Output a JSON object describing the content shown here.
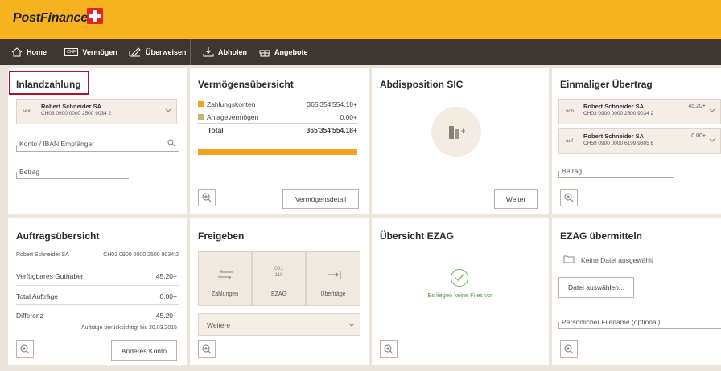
{
  "brand": {
    "name": "PostFinance",
    "accent": "#f5b41f",
    "nav_bg": "#3e3731",
    "highlight": "#b00f2d",
    "bar_color": "#f5a21c"
  },
  "nav": {
    "items": [
      {
        "label": "Home",
        "icon": "home-icon"
      },
      {
        "label": "Vermögen",
        "icon": "chf-icon"
      },
      {
        "label": "Überweisen",
        "icon": "pen-icon"
      },
      {
        "label": "Abholen",
        "icon": "download-icon"
      },
      {
        "label": "Angebote",
        "icon": "gift-icon"
      }
    ],
    "chf_badge": "CHF"
  },
  "inlandzahlung": {
    "title": "Inlandzahlung",
    "from_prefix": "von",
    "account_name": "Robert Schneider SA",
    "account_iban": "CH03 0900 0000 2500 9034 2",
    "recipient_placeholder": "Konto / IBAN Empfänger",
    "amount_placeholder": "Betrag"
  },
  "vermoegen": {
    "title": "Vermögensübersicht",
    "rows": [
      {
        "label": "Zahlungskonten",
        "value": "365'354'554.18+",
        "color": "#f5a21c"
      },
      {
        "label": "Anlagevermögen",
        "value": "0.00+",
        "color": "#c9b56b"
      }
    ],
    "total_label": "Total",
    "total_value": "365'354'554.18+",
    "bar_fraction": 1.0,
    "detail_button": "Vermögensdetail"
  },
  "abdisposition": {
    "title": "Abdisposition SIC",
    "button": "Weiter"
  },
  "einmalig": {
    "title": "Einmaliger Übertrag",
    "from_prefix": "von",
    "from_name": "Robert Schneider SA",
    "from_iban": "CH03 0900 0000 2500 9034 2",
    "from_amount": "45.20+",
    "to_prefix": "auf",
    "to_name": "Robert Schneider SA",
    "to_iban": "CH59 0900 0000 6199 9805 8",
    "to_amount": "0.00+",
    "amount_placeholder": "Betrag"
  },
  "auftrag": {
    "title": "Auftragsübersicht",
    "account_name": "Robert Schneider SA",
    "account_iban": "CH03 0900 0000 2500 9034 2",
    "rows": [
      {
        "label": "Verfügbares Guthaben",
        "value": "45.20+"
      },
      {
        "label": "Total Aufträge",
        "value": "0.00+"
      },
      {
        "label": "Differenz",
        "value": "45.20+"
      }
    ],
    "note": "Aufträge berücksichtigt bis 20.03.2015",
    "button": "Anderes Konto"
  },
  "freigeben": {
    "title": "Freigeben",
    "cells": [
      {
        "label": "Zahlungen"
      },
      {
        "label": "EZAG",
        "icon_line1": "001",
        "icon_line2": "110"
      },
      {
        "label": "Überträge"
      }
    ],
    "dropdown": "Weitere"
  },
  "ezag_overview": {
    "title": "Übersicht EZAG",
    "message": "Es liegen keine Files vor",
    "message_color": "#4e9a3f"
  },
  "ezag_send": {
    "title": "EZAG übermitteln",
    "no_file": "Keine Datei ausgewählt",
    "choose_button": "Datei auswählen...",
    "filename_placeholder": "Persönlicher Filename (optional)"
  }
}
